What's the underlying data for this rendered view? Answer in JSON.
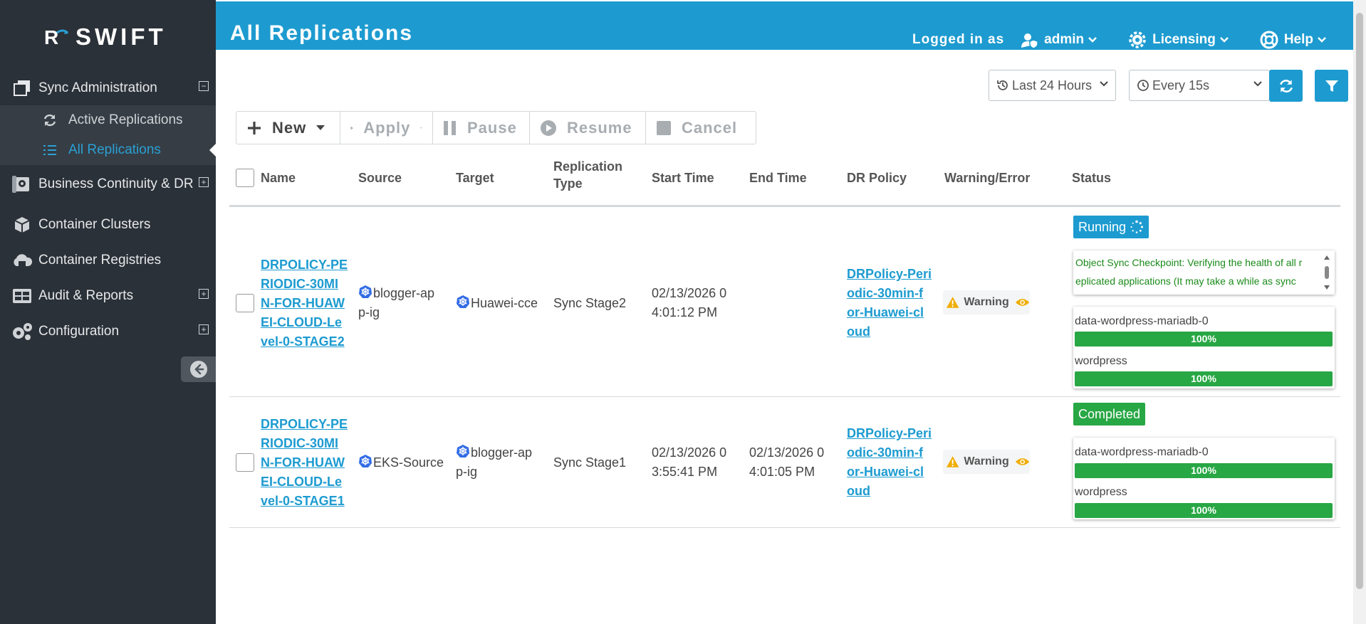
{
  "app": {
    "brand": "SWIFT",
    "page_title": "All Replications"
  },
  "header": {
    "logged_in_label": "Logged in as",
    "user": "admin",
    "licensing": "Licensing",
    "help": "Help",
    "brand_color": "#1d9bd0"
  },
  "sidebar": {
    "sections": [
      {
        "label": "Sync Administration",
        "icon": "sync-admin-icon",
        "expander": "⊟"
      },
      {
        "label": "Business Continuity & DR",
        "icon": "business-continuity-icon",
        "expander": "⊞"
      },
      {
        "label": "Container Clusters",
        "icon": "cube-icon"
      },
      {
        "label": "Container Registries",
        "icon": "cloud-registry-icon"
      },
      {
        "label": "Audit & Reports",
        "icon": "table-icon",
        "expander": "⊞"
      },
      {
        "label": "Configuration",
        "icon": "gears-icon",
        "expander": "⊞"
      }
    ],
    "sub_items": [
      {
        "label": "Active Replications",
        "icon": "refresh-icon"
      },
      {
        "label": "All Replications",
        "icon": "list-icon",
        "active": true
      }
    ]
  },
  "filters": {
    "time_range": "Last 24 Hours",
    "refresh_interval": "Every 15s"
  },
  "toolbar": {
    "new": "New",
    "apply": "Apply",
    "pause": "Pause",
    "resume": "Resume",
    "cancel": "Cancel"
  },
  "table": {
    "columns": [
      "Name",
      "Source",
      "Target",
      "Replication Type",
      "Start Time",
      "End Time",
      "DR Policy",
      "Warning/Error",
      "Status"
    ],
    "rows": [
      {
        "name_lines": [
          "DRPOLICY-PE",
          "RIODIC-30MI",
          "N-FOR-HUAW",
          "EI-CLOUD-Le",
          "vel-0-STAGE2"
        ],
        "source_lines": [
          "blogger-ap",
          "p-ig"
        ],
        "target_lines": [
          "Huawei-cce"
        ],
        "replication_type": "Sync Stage2",
        "start_time_lines": [
          "02/13/2026 0",
          "4:01:12 PM"
        ],
        "end_time_lines": [],
        "dr_policy_lines": [
          "DRPolicy-Peri",
          "odic-30min-f",
          "or-Huawei-cl",
          "oud"
        ],
        "warning": "Warning",
        "status": "Running",
        "status_color": "#1d9bd0",
        "message_lines": [
          "Object Sync Checkpoint: Verifying the health of all r",
          "eplicated applications (It may take a while as sync"
        ],
        "progress": [
          {
            "name": "data-wordpress-mariadb-0",
            "percent": 100,
            "label": "100%"
          },
          {
            "name": "wordpress",
            "percent": 100,
            "label": "100%"
          }
        ]
      },
      {
        "name_lines": [
          "DRPOLICY-PE",
          "RIODIC-30MI",
          "N-FOR-HUAW",
          "EI-CLOUD-Le",
          "vel-0-STAGE1"
        ],
        "source_lines": [
          "EKS-Source"
        ],
        "target_lines": [
          "blogger-ap",
          "p-ig"
        ],
        "replication_type": "Sync Stage1",
        "start_time_lines": [
          "02/13/2026 0",
          "3:55:41 PM"
        ],
        "end_time_lines": [
          "02/13/2026 0",
          "4:01:05 PM"
        ],
        "dr_policy_lines": [
          "DRPolicy-Peri",
          "odic-30min-f",
          "or-Huawei-cl",
          "oud"
        ],
        "warning": "Warning",
        "status": "Completed",
        "status_color": "#28a745",
        "progress": [
          {
            "name": "data-wordpress-mariadb-0",
            "percent": 100,
            "label": "100%"
          },
          {
            "name": "wordpress",
            "percent": 100,
            "label": "100%"
          }
        ]
      }
    ]
  }
}
